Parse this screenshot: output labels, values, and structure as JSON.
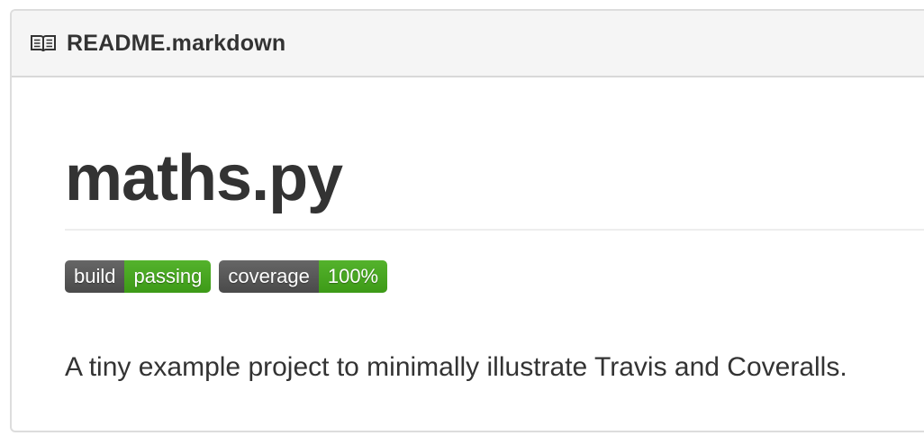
{
  "header": {
    "icon": "book-icon",
    "filename": "README.markdown"
  },
  "readme": {
    "title": "maths.py",
    "badges": [
      {
        "label": "build",
        "value": "passing",
        "label_color": "#555555",
        "value_color": "#4c1"
      },
      {
        "label": "coverage",
        "value": "100%",
        "label_color": "#555555",
        "value_color": "#4c1"
      }
    ],
    "description": "A tiny example project to minimally illustrate Travis and Coveralls."
  },
  "colors": {
    "header_bg": "#f5f5f5",
    "border": "#dddddd",
    "text": "#333333",
    "badge_green": "#44a820"
  }
}
